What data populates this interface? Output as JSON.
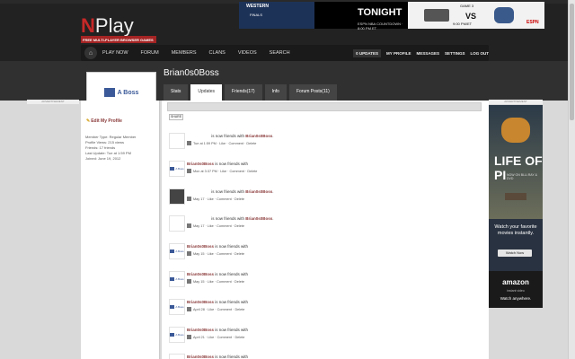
{
  "brand": {
    "logo_n": "N",
    "logo_rest": "Play",
    "tagline": "FREE MULTI-PLAYER BROWSER GAMES"
  },
  "banner": {
    "left_title": "WESTERN",
    "left_sub": "FINALS",
    "mid_title": "TONIGHT",
    "mid_sub": "ESPN NBA COUNTDOWN · 8:00 PM ET",
    "game": "GAME 3",
    "vs": "VS",
    "time": "9:00 PM/ET",
    "network": "ESPN"
  },
  "nav": {
    "home_icon": "home-icon",
    "items": [
      "PLAY NOW",
      "FORUM",
      "MEMBERS",
      "CLANS",
      "VIDEOS",
      "SEARCH"
    ],
    "right": {
      "updates": "0 UPDATES",
      "my_profile": "MY PROFILE",
      "messages": "MESSAGES",
      "settings": "SETTINGS",
      "log_out": "LOG OUT"
    }
  },
  "profile": {
    "username": "Brian0s0Boss",
    "avatar_text": "A Boss",
    "edit_label": "Edit My Profile",
    "tabs": [
      "Stats",
      "Updates",
      "Friends(17)",
      "Info",
      "Forum Posts(11)"
    ],
    "active_tab": "Updates",
    "info": {
      "member_type": "Member Type: Regular Member",
      "views": "Profile Views: 215 views",
      "friends": "Friends: 17 friends",
      "last_update": "Last Update: Tue at 1:59 PM",
      "joined": "Joined: June 19, 2012"
    }
  },
  "ads": {
    "label": "ADVERTISEMENT"
  },
  "share_label": "SHARE",
  "feed": [
    {
      "pre": "",
      "mid": " is now friends with ",
      "link": "Brian0s0Boss",
      "post": ".",
      "when": "Tue at 1:59 PM",
      "actions": [
        "Like",
        "Comment",
        "Delete"
      ]
    },
    {
      "pre": "Brian0s0Boss",
      "mid": " is now friends with ",
      "link": "",
      "post": "",
      "when": "Mon at 3:37 PM",
      "actions": [
        "Like",
        "Comment",
        "Delete"
      ]
    },
    {
      "pre": "",
      "mid": " is now friends with ",
      "link": "Brian0s0Boss",
      "post": ".",
      "when": "May 17",
      "actions": [
        "Like",
        "Comment",
        "Delete"
      ]
    },
    {
      "pre": "",
      "mid": " is now friends with ",
      "link": "Brian0s0Boss",
      "post": ".",
      "when": "May 17",
      "actions": [
        "Like",
        "Comment",
        "Delete"
      ]
    },
    {
      "pre": "Brian0s0Boss",
      "mid": " is now friends with ",
      "link": "",
      "post": "",
      "when": "May 15",
      "actions": [
        "Like",
        "Comment",
        "Delete"
      ]
    },
    {
      "pre": "Brian0s0Boss",
      "mid": " is now friends with ",
      "link": "",
      "post": "",
      "when": "May 15",
      "actions": [
        "Like",
        "Comment",
        "Delete"
      ]
    },
    {
      "pre": "Brian0s0Boss",
      "mid": " is now friends with ",
      "link": "",
      "post": "",
      "when": "April 28",
      "actions": [
        "Like",
        "Comment",
        "Delete"
      ]
    },
    {
      "pre": "Brian0s0Boss",
      "mid": " is now friends with ",
      "link": "",
      "post": "",
      "when": "April 21",
      "actions": [
        "Like",
        "Comment",
        "Delete"
      ]
    },
    {
      "pre": "Brian0s0Boss",
      "mid": " is now friends with ",
      "link": "",
      "post": "",
      "when": "",
      "actions": []
    }
  ],
  "right_ad": {
    "title": "LIFE OF PI",
    "sub": "NOW ON BLU-RAY & DVD",
    "watch": "Watch your favorite movies instantly.",
    "button": "Watch Now",
    "brand": "amazon",
    "brand_sub": "instant video",
    "watch_now": "Watch anywhere."
  }
}
